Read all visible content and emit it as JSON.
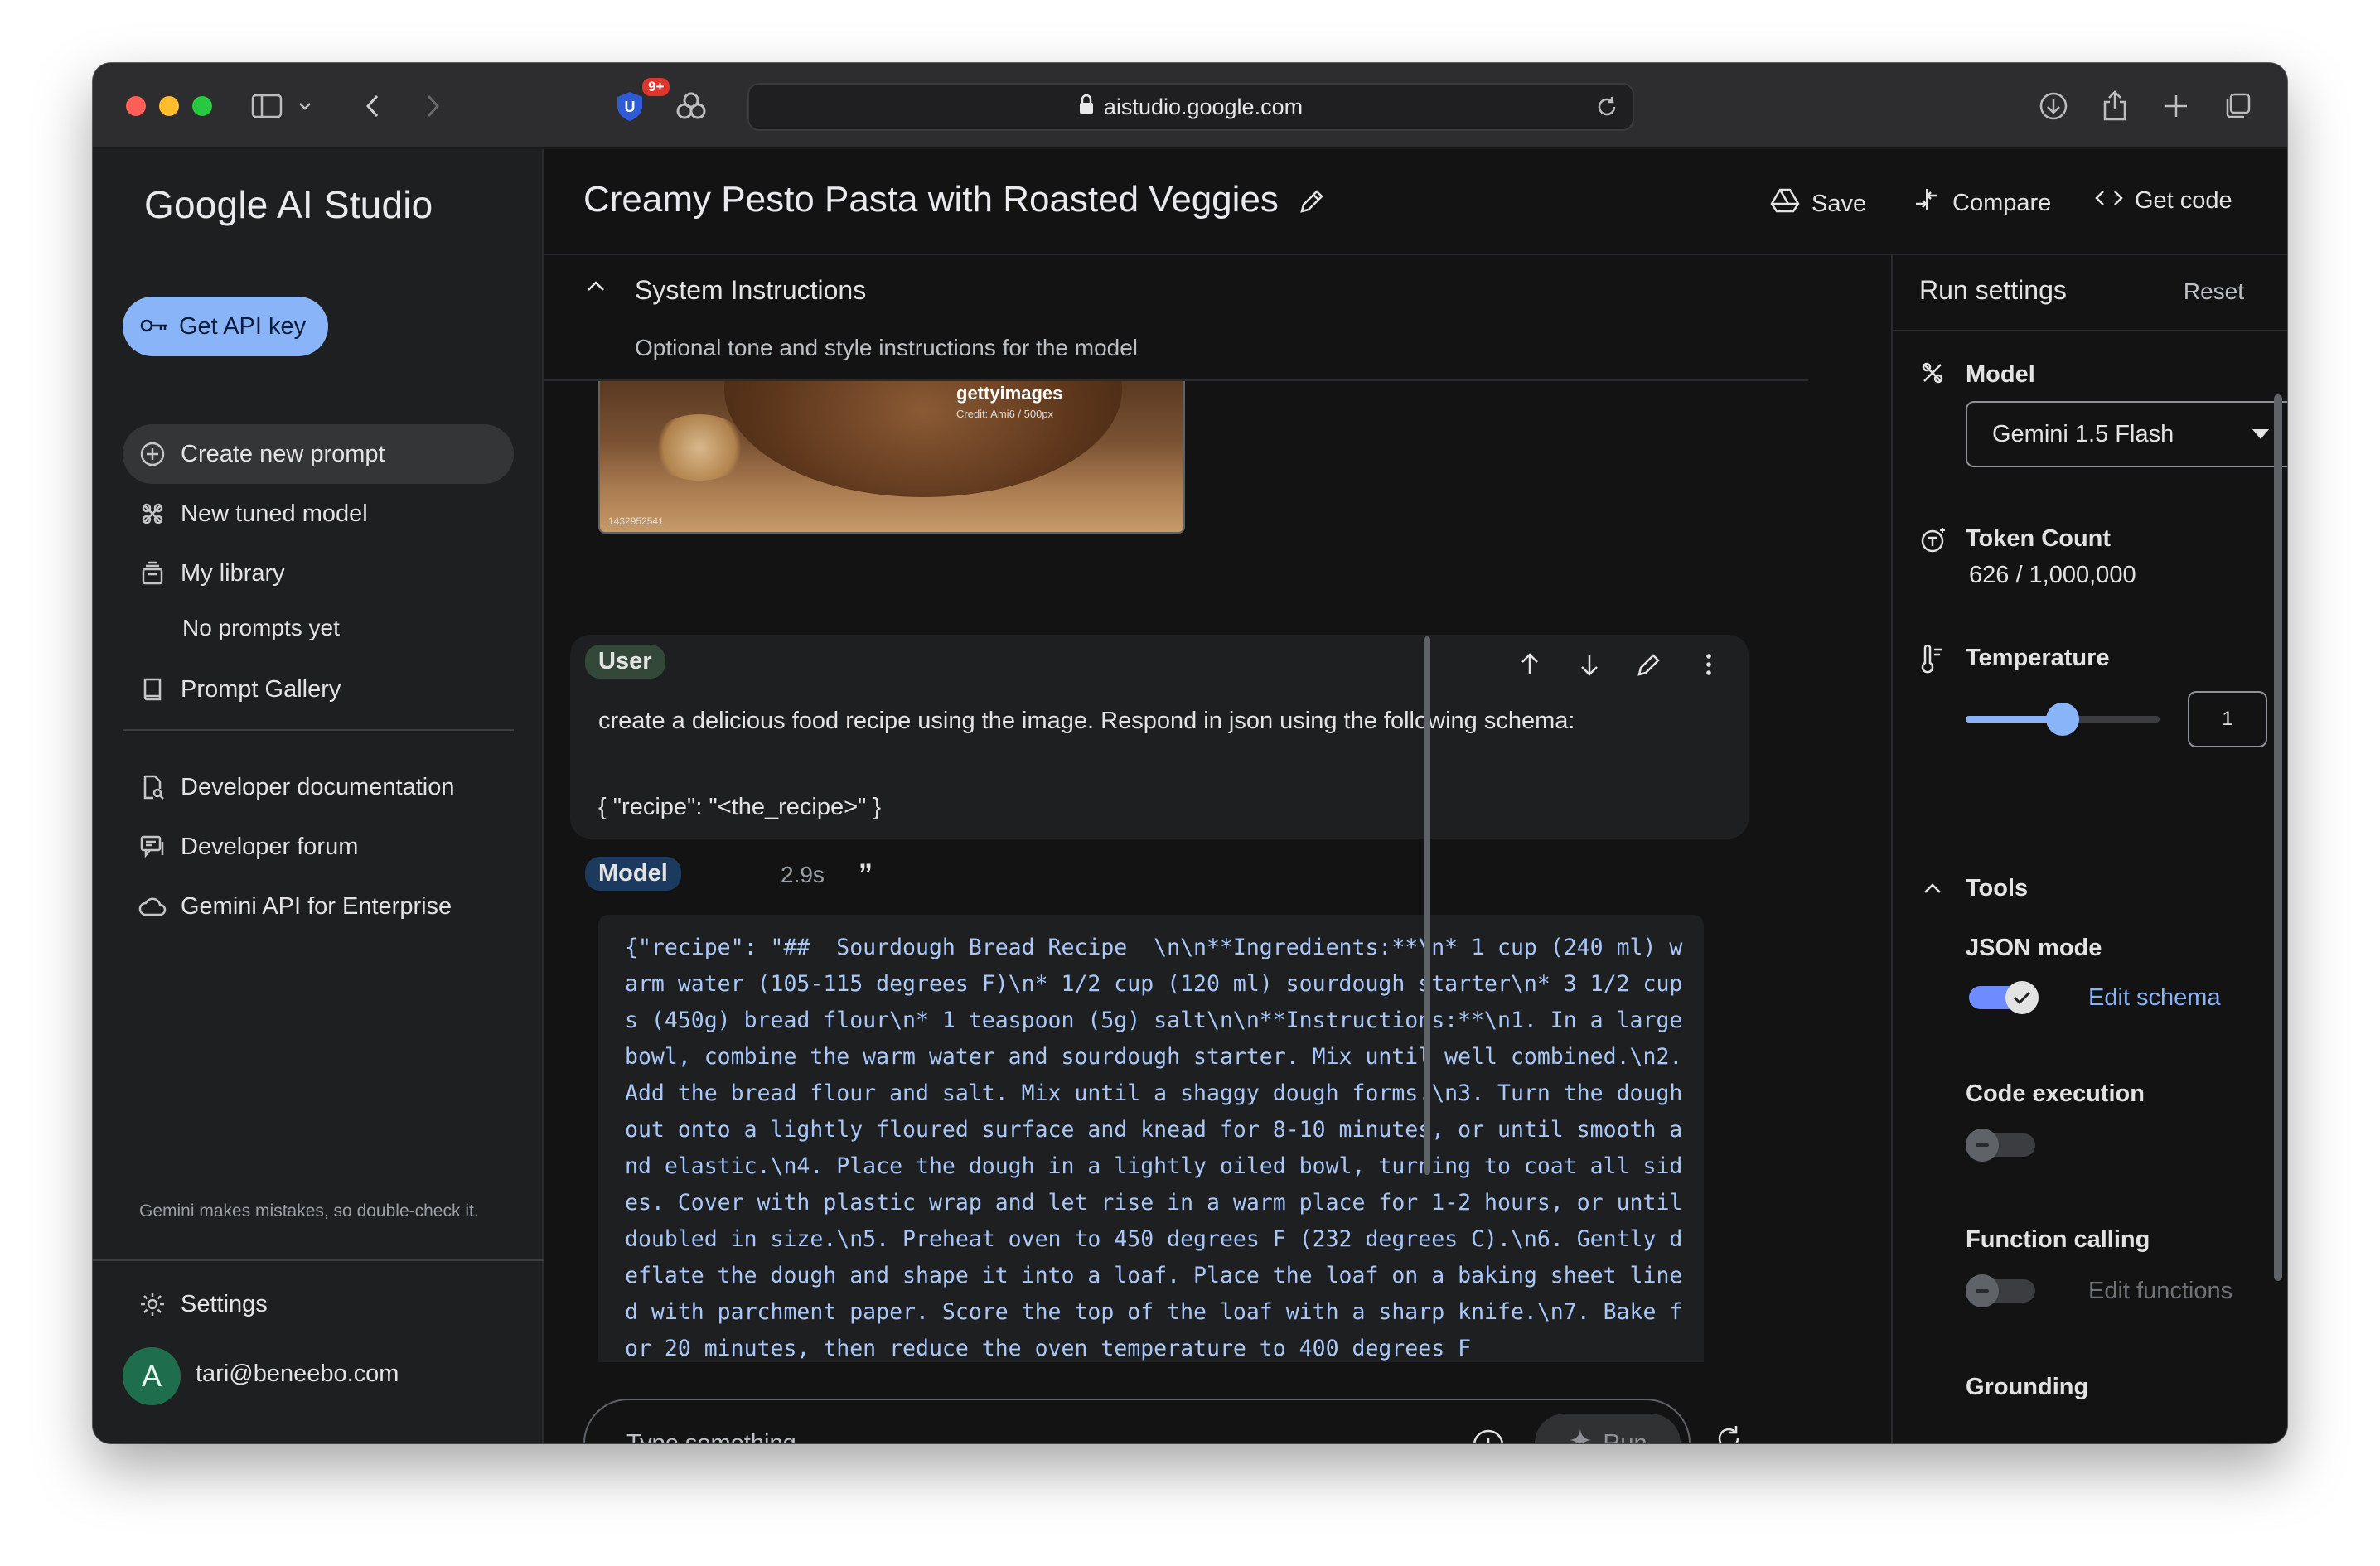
{
  "browser": {
    "url": "aistudio.google.com",
    "extension_badge": "9+"
  },
  "sidebar": {
    "brand": "Google AI Studio",
    "api_key_label": "Get API key",
    "items": [
      {
        "label": "Create new prompt",
        "icon": "plus-circle-icon"
      },
      {
        "label": "New tuned model",
        "icon": "tune-icon"
      },
      {
        "label": "My library",
        "icon": "library-icon"
      },
      {
        "label": "No prompts yet",
        "icon": ""
      },
      {
        "label": "Prompt Gallery",
        "icon": "book-icon"
      }
    ],
    "resources": [
      {
        "label": "Developer documentation",
        "icon": "docs-icon"
      },
      {
        "label": "Developer forum",
        "icon": "forum-icon"
      },
      {
        "label": "Gemini API for Enterprise",
        "icon": "cloud-icon"
      }
    ],
    "disclaimer": "Gemini makes mistakes, so double-check it.",
    "settings_label": "Settings",
    "avatar_initial": "A",
    "user_email": "tari@beneebo.com"
  },
  "header": {
    "title": "Creamy Pesto Pasta with Roasted Veggies",
    "save_label": "Save",
    "compare_label": "Compare",
    "get_code_label": "Get code"
  },
  "system_instructions": {
    "title": "System Instructions",
    "placeholder": "Optional tone and style instructions for the model"
  },
  "image": {
    "watermark": "gettyimages",
    "credit": "Credit: Ami6 / 500px",
    "id": "1432952541"
  },
  "user_turn": {
    "role": "User",
    "line1": "create a delicious food recipe using the image. Respond in json using the following schema:",
    "line2": "{ \"recipe\": \"<the_recipe>\" }"
  },
  "model_turn": {
    "role": "Model",
    "time": "2.9s",
    "quote_icon": "”",
    "response": "{\"recipe\": \"##  Sourdough Bread Recipe  \\n\\n**Ingredients:**\\n* 1 cup (240 ml) warm water (105-115 degrees F)\\n* 1/2 cup (120 ml) sourdough starter\\n* 3 1/2 cups (450g) bread flour\\n* 1 teaspoon (5g) salt\\n\\n**Instructions:**\\n1. In a large bowl, combine the warm water and sourdough starter. Mix until well combined.\\n2. Add the bread flour and salt. Mix until a shaggy dough forms.\\n3. Turn the dough out onto a lightly floured surface and knead for 8-10 minutes, or until smooth and elastic.\\n4. Place the dough in a lightly oiled bowl, turning to coat all sides. Cover with plastic wrap and let rise in a warm place for 1-2 hours, or until doubled in size.\\n5. Preheat oven to 450 degrees F (232 degrees C).\\n6. Gently deflate the dough and shape it into a loaf. Place the loaf on a baking sheet lined with parchment paper. Score the top of the loaf with a sharp knife.\\n7. Bake for 20 minutes, then reduce the oven temperature to 400 degrees F"
  },
  "composer": {
    "placeholder": "Type something",
    "run_label": "Run"
  },
  "run_settings": {
    "title": "Run settings",
    "reset_label": "Reset",
    "model_label": "Model",
    "model_value": "Gemini 1.5 Flash",
    "token_label": "Token Count",
    "token_value": "626 / 1,000,000",
    "temperature_label": "Temperature",
    "temperature_value": "1",
    "temperature_fraction": 0.5,
    "tools_label": "Tools",
    "json_mode_label": "JSON mode",
    "json_mode_on": true,
    "edit_schema_label": "Edit schema",
    "code_execution_label": "Code execution",
    "code_execution_on": false,
    "function_calling_label": "Function calling",
    "function_calling_on": false,
    "edit_functions_label": "Edit functions",
    "grounding_label": "Grounding"
  },
  "colors": {
    "accent": "#8ab4f8",
    "background": "#131314",
    "surface": "#1e1f20"
  }
}
